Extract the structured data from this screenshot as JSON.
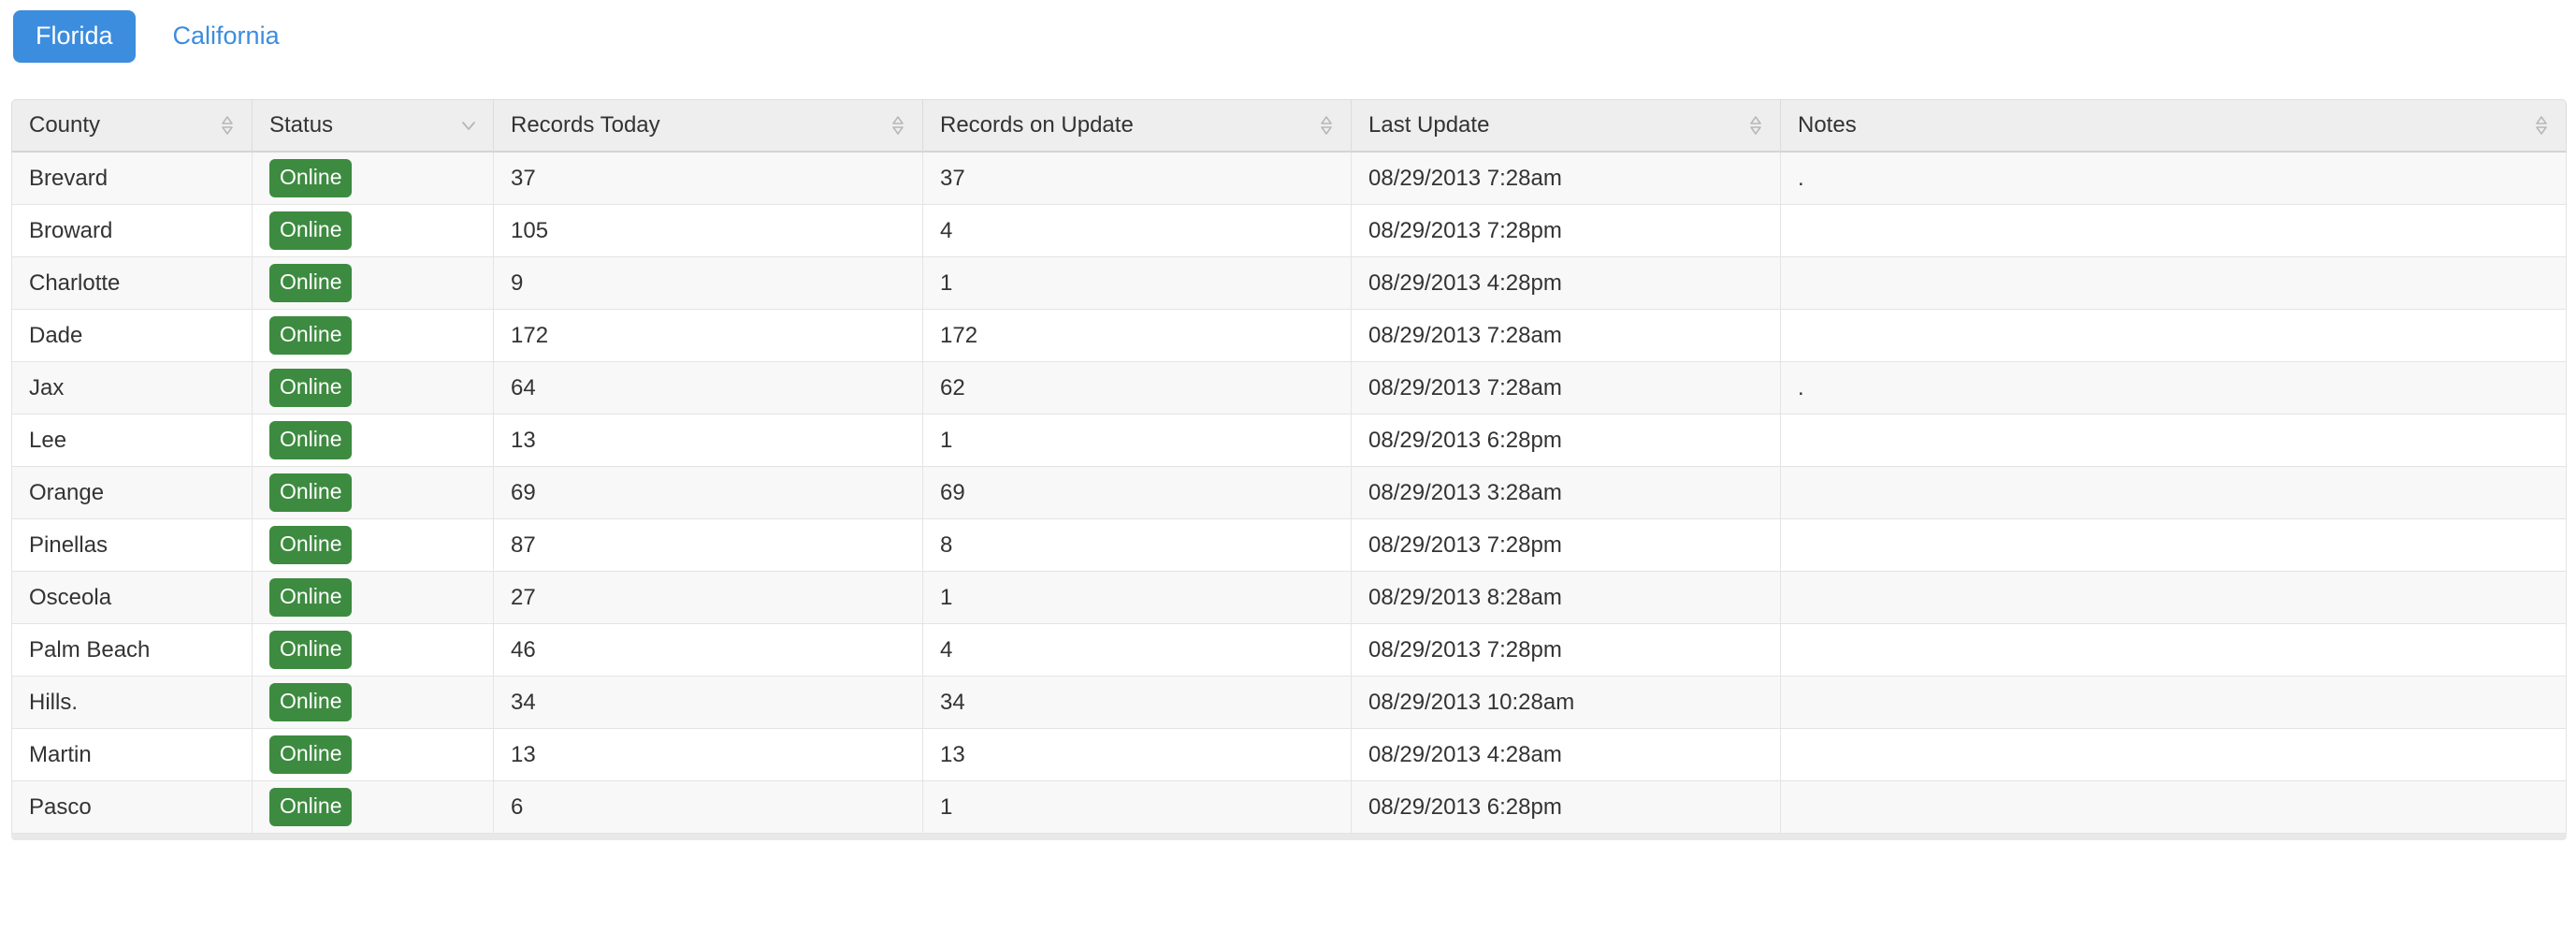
{
  "tabs": [
    {
      "label": "Florida",
      "active": true
    },
    {
      "label": "California",
      "active": false
    }
  ],
  "colors": {
    "tab_active_bg": "#3c8dde",
    "tab_link_text": "#3c8dde",
    "badge_online_bg": "#3d8b40",
    "header_bg": "#eeeeee",
    "row_stripe_bg": "#f8f8f8"
  },
  "table": {
    "columns": [
      {
        "label": "County",
        "sort_icon": "sort-both-icon"
      },
      {
        "label": "Status",
        "sort_icon": "sort-desc-icon"
      },
      {
        "label": "Records Today",
        "sort_icon": "sort-both-icon"
      },
      {
        "label": "Records on Update",
        "sort_icon": "sort-both-icon"
      },
      {
        "label": "Last Update",
        "sort_icon": "sort-both-icon"
      },
      {
        "label": "Notes",
        "sort_icon": "sort-both-icon"
      }
    ],
    "rows": [
      {
        "county": "Brevard",
        "status": "Online",
        "records_today": "37",
        "records_on_update": "37",
        "last_update": "08/29/2013 7:28am",
        "notes": "."
      },
      {
        "county": "Broward",
        "status": "Online",
        "records_today": "105",
        "records_on_update": "4",
        "last_update": "08/29/2013 7:28pm",
        "notes": ""
      },
      {
        "county": "Charlotte",
        "status": "Online",
        "records_today": "9",
        "records_on_update": "1",
        "last_update": "08/29/2013 4:28pm",
        "notes": ""
      },
      {
        "county": "Dade",
        "status": "Online",
        "records_today": "172",
        "records_on_update": "172",
        "last_update": "08/29/2013 7:28am",
        "notes": ""
      },
      {
        "county": "Jax",
        "status": "Online",
        "records_today": "64",
        "records_on_update": "62",
        "last_update": "08/29/2013 7:28am",
        "notes": "."
      },
      {
        "county": "Lee",
        "status": "Online",
        "records_today": "13",
        "records_on_update": "1",
        "last_update": "08/29/2013 6:28pm",
        "notes": ""
      },
      {
        "county": "Orange",
        "status": "Online",
        "records_today": "69",
        "records_on_update": "69",
        "last_update": "08/29/2013 3:28am",
        "notes": ""
      },
      {
        "county": "Pinellas",
        "status": "Online",
        "records_today": "87",
        "records_on_update": "8",
        "last_update": "08/29/2013 7:28pm",
        "notes": ""
      },
      {
        "county": "Osceola",
        "status": "Online",
        "records_today": "27",
        "records_on_update": "1",
        "last_update": "08/29/2013 8:28am",
        "notes": ""
      },
      {
        "county": "Palm Beach",
        "status": "Online",
        "records_today": "46",
        "records_on_update": "4",
        "last_update": "08/29/2013 7:28pm",
        "notes": ""
      },
      {
        "county": "Hills.",
        "status": "Online",
        "records_today": "34",
        "records_on_update": "34",
        "last_update": "08/29/2013 10:28am",
        "notes": ""
      },
      {
        "county": "Martin",
        "status": "Online",
        "records_today": "13",
        "records_on_update": "13",
        "last_update": "08/29/2013 4:28am",
        "notes": ""
      },
      {
        "county": "Pasco",
        "status": "Online",
        "records_today": "6",
        "records_on_update": "1",
        "last_update": "08/29/2013 6:28pm",
        "notes": ""
      }
    ]
  }
}
